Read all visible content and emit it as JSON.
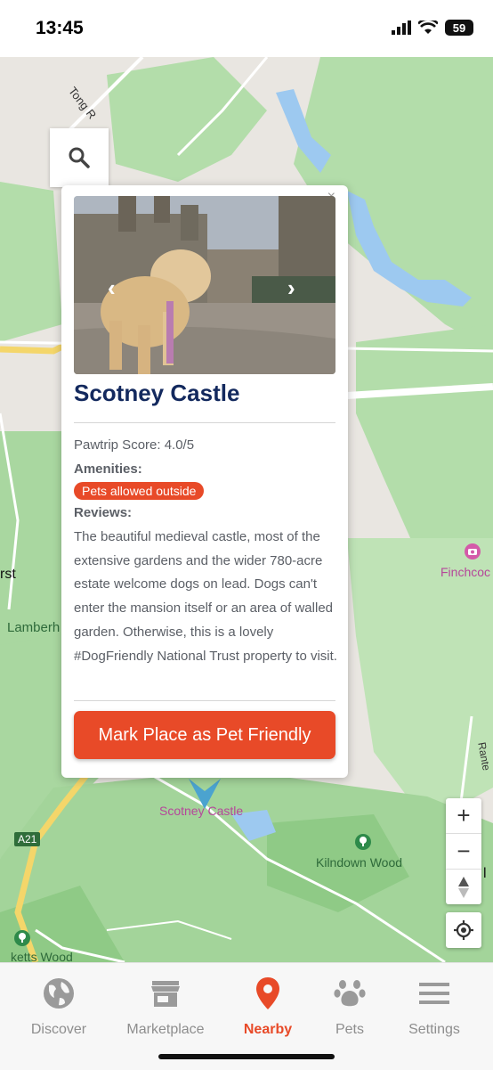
{
  "status_bar": {
    "time": "13:45",
    "battery": "59"
  },
  "map": {
    "labels": {
      "tong_road": "Tong R",
      "rst": "rst",
      "lamberhurst": "Lamberh",
      "finchcocks": "Finchcoc",
      "scotney_castle": "Scotney Castle",
      "a21": "A21",
      "kilndown_wood": "Kilndown Wood",
      "bewl": "l",
      "ketts_wood": "ketts Wood",
      "ranters": "Rante"
    },
    "colors": {
      "land": "#e9e6e1",
      "green": "#a8d9a0",
      "water": "#9dc9f0",
      "road_yellow": "#f4d66a"
    }
  },
  "popup": {
    "title": "Scotney Castle",
    "close_label": "×",
    "score": "Pawtrip Score: 4.0/5",
    "amenities_label": "Amenities:",
    "amenity_badge": "Pets allowed outside",
    "reviews_label": "Reviews:",
    "review_text": "The beautiful medieval castle, most of the extensive gardens and the wider 780-acre estate welcome dogs on lead. Dogs can't enter the mansion itself or an area of walled garden. Otherwise, this is a lovely #DogFriendly National Trust property to visit.",
    "cta_label": "Mark Place as Pet Friendly",
    "prev_arrow": "‹",
    "next_arrow": "›",
    "accent_color": "#e84a28",
    "title_color": "#13295e"
  },
  "map_controls": {
    "zoom_in": "+",
    "zoom_out": "−"
  },
  "tabs": [
    {
      "label": "Discover",
      "icon": "globe-icon",
      "active": false
    },
    {
      "label": "Marketplace",
      "icon": "store-icon",
      "active": false
    },
    {
      "label": "Nearby",
      "icon": "map-pin-icon",
      "active": true
    },
    {
      "label": "Pets",
      "icon": "paw-icon",
      "active": false
    },
    {
      "label": "Settings",
      "icon": "menu-icon",
      "active": false
    }
  ]
}
